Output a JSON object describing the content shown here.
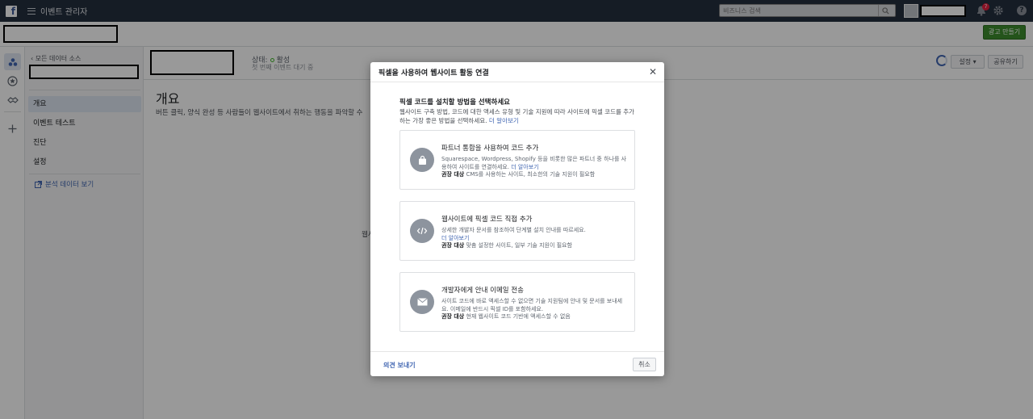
{
  "topbar": {
    "logo": "f",
    "app_title": "이벤트 관리자",
    "search_placeholder": "비즈니스 검색",
    "notification_count": "7"
  },
  "subbar": {
    "create_ad_label": "광고 만들기"
  },
  "sidenav": {
    "back_label": "모든 데이터 소스",
    "items": [
      {
        "label": "개요",
        "active": true
      },
      {
        "label": "이벤트 테스트",
        "active": false
      },
      {
        "label": "진단",
        "active": false
      },
      {
        "label": "설정",
        "active": false
      }
    ],
    "analytics_label": "분석 데이터 보기"
  },
  "main": {
    "status_label": "상태:",
    "status_value": "활성",
    "status_sub": "첫 번째 이벤트 대기 중",
    "settings_label": "설정",
    "share_label": "공유하기",
    "title": "개요",
    "description": "버튼 클릭, 양식 완성 등 사람들이 웹사이트에서 취하는 행동을 파악할 수",
    "fragment": "웹사"
  },
  "modal": {
    "title": "픽셀을 사용하여 웹사이트 활동 연결",
    "heading": "픽셀 코드를 설치할 방법을 선택하세요",
    "description": "웹사이트 구축 방법, 코드에 대한 액세스 유형 및 기술 지원에 따라 사이트에 픽셀 코드를 추가하는 가장 좋은 방법을 선택하세요.",
    "learn_more": "더 알아보기",
    "options": [
      {
        "icon": "shopping-bag-icon",
        "title": "파트너 통합을 사용하여 코드 추가",
        "line1": "Squarespace, Wordpress, Shopify 등을 비롯한 많은 파트너 중 하나를 사용하여 사이트를 연결하세요.",
        "line1_link": "더 알아보기",
        "recommended_label": "권장 대상",
        "recommended_text": "CMS를 사용하는 사이트, 최소한의 기술 지원이 필요함"
      },
      {
        "icon": "code-icon",
        "title": "웹사이트에 픽셀 코드 직접 추가",
        "line1": "상세한 개발자 문서를 참조하여 단계별 설치 안내를 따르세요.",
        "line1_link": "더 알아보기",
        "recommended_label": "권장 대상",
        "recommended_text": "맞춤 설정한 사이트, 일부 기술 지원이 필요함"
      },
      {
        "icon": "envelope-icon",
        "title": "개발자에게 안내 이메일 전송",
        "line1": "사이트 코드에 바로 액세스할 수 없으면 기술 지원팀에 안내 및 문서를 보내세요. 이메일에 반드시 픽셀 ID를 포함하세요.",
        "line1_link": "",
        "recommended_label": "권장 대상",
        "recommended_text": "현재 웹사이트 코드 기반에 액세스할 수 없음"
      }
    ],
    "feedback_label": "의견 보내기",
    "cancel_label": "취소"
  }
}
